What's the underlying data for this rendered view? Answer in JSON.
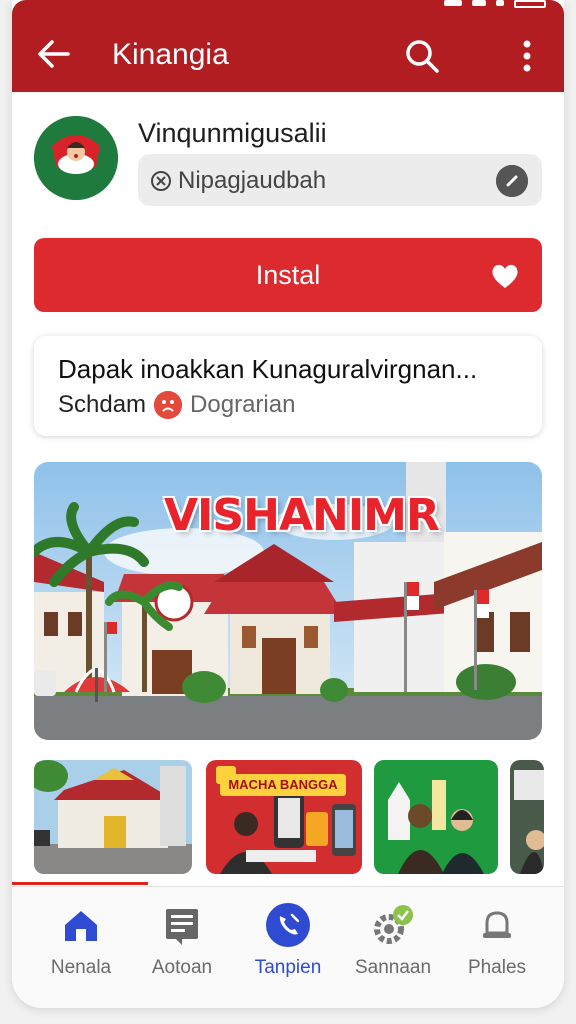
{
  "appbar": {
    "title": "Kinangia",
    "back_icon": "arrow-left-icon",
    "search_icon": "search-icon",
    "more_icon": "more-vertical-icon",
    "color": "#b21d22"
  },
  "app": {
    "name": "Vinqunmigusalii",
    "developer": "Nipagjaudbah"
  },
  "install": {
    "label": "Instal",
    "color": "#dc2a2f"
  },
  "info": {
    "headline": "Dapak inoakkan Kunaguralvirgnan...",
    "sub_label": "Schdam",
    "sub_value": "Dograrian"
  },
  "banner": {
    "text": "VISHANIMR"
  },
  "thumbnails": [
    {
      "name": "building-thumbnail"
    },
    {
      "name": "promo-thumbnail",
      "title": "MACHA BANGGA"
    },
    {
      "name": "people-thumbnail"
    },
    {
      "name": "partial-thumbnail"
    }
  ],
  "nav": {
    "items": [
      {
        "label": "Nenala",
        "icon": "home-icon",
        "active": false
      },
      {
        "label": "Aotoan",
        "icon": "document-icon",
        "active": false
      },
      {
        "label": "Tanpien",
        "icon": "phone-icon",
        "active": true
      },
      {
        "label": "Sannaan",
        "icon": "settings-icon",
        "active": false
      },
      {
        "label": "Phales",
        "icon": "bell-icon",
        "active": false
      }
    ],
    "active_color": "#2f4bd1"
  }
}
